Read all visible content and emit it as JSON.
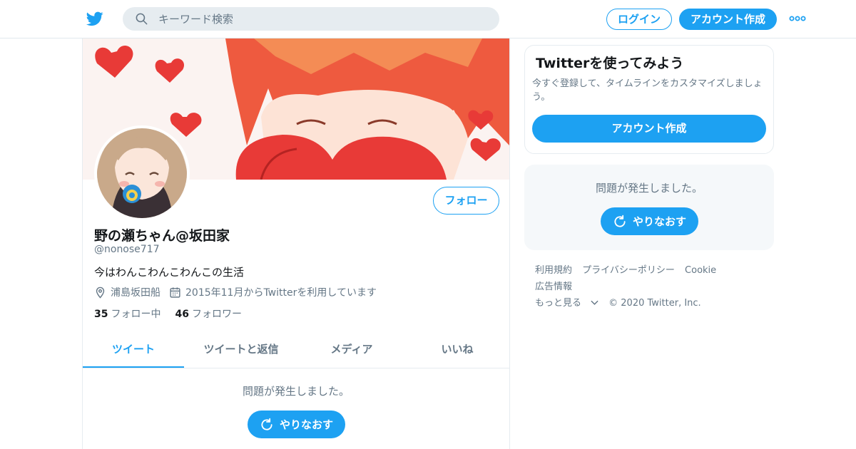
{
  "header": {
    "search_placeholder": "キーワード検索",
    "login_label": "ログイン",
    "signup_label": "アカウント作成",
    "accent_color": "#1da1f2"
  },
  "profile": {
    "follow_label": "フォロー",
    "name": "野の瀬ちゃん@坂田家",
    "handle": "@nonose717",
    "bio": "今はわんこわんこわんこの生活",
    "location": "浦島坂田船",
    "joined": "2015年11月からTwitterを利用しています",
    "following_count": "35",
    "following_label": "フォロー中",
    "followers_count": "46",
    "followers_label": "フォロワー"
  },
  "tabs": [
    {
      "label": "ツイート",
      "active": true
    },
    {
      "label": "ツイートと返信",
      "active": false
    },
    {
      "label": "メディア",
      "active": false
    },
    {
      "label": "いいね",
      "active": false
    }
  ],
  "timeline": {
    "error_text": "問題が発生しました。",
    "retry_label": "やりなおす"
  },
  "sidebar": {
    "signup_card": {
      "title": "Twitterを使ってみよう",
      "description": "今すぐ登録して、タイムラインをカスタマイズしましょう。",
      "button_label": "アカウント作成"
    },
    "error_box": {
      "error_text": "問題が発生しました。",
      "retry_label": "やりなおす"
    },
    "footer": {
      "links": [
        "利用規約",
        "プライバシーポリシー",
        "Cookie",
        "広告情報"
      ],
      "more_label": "もっと見る",
      "copyright": "© 2020 Twitter, Inc."
    }
  }
}
